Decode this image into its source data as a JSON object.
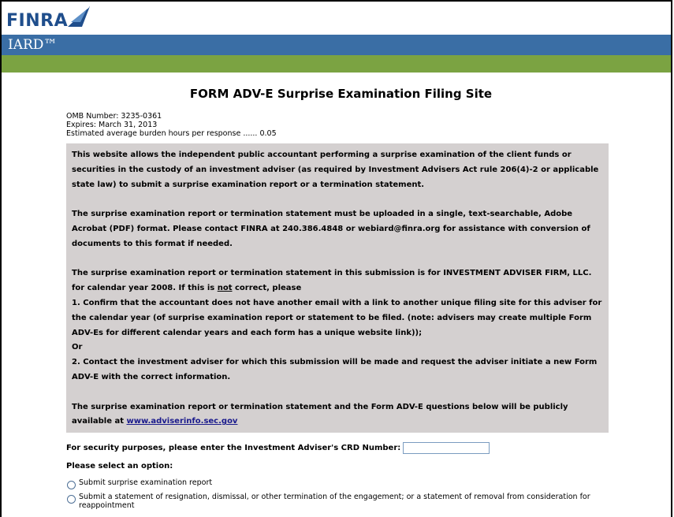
{
  "header": {
    "logo_text": "FINRA",
    "product_name": "IARD™"
  },
  "page": {
    "title": "FORM ADV-E Surprise Examination Filing Site"
  },
  "omb": {
    "number": "OMB Number: 3235-0361",
    "expires": "Expires: March 31, 2013",
    "burden": "Estimated average burden hours per response ...... 0.05"
  },
  "info": {
    "para1": "This website allows the independent public accountant performing a surprise examination of the client funds or securities in the custody of an investment adviser (as required by Investment Advisers Act rule 206(4)-2 or applicable state law) to submit a surprise examination report or a termination statement.",
    "para2": "The surprise examination report or termination statement must be uploaded in a single, text-searchable, Adobe Acrobat (PDF) format. Please contact FINRA at 240.386.4848 or webiard@finra.org for assistance with conversion of documents to this format if needed.",
    "para3_line1": "The surprise examination report or termination statement in this submission is for INVESTMENT ADVISER FIRM, LLC.",
    "para3_line2_pre": "for calendar year 2008. If this is ",
    "para3_line2_not": "not",
    "para3_line2_post": " correct, please",
    "para3_item1": "1. Confirm that the accountant does not have another email with a link to another unique filing site for this adviser for the calendar year (of surprise examination report or statement to be filed. (note: advisers may create multiple Form ADV-Es for different calendar years and each form has a unique website link));",
    "para3_or": "Or",
    "para3_item2": "2. Contact the investment adviser for which this submission will be made and request the adviser initiate a new Form ADV-E with the correct information.",
    "para4_pre": "The surprise examination report or termination statement and the Form ADV-E questions below will be publicly available at ",
    "para4_link": "www.adviserinfo.sec.gov"
  },
  "crd": {
    "label": "For security purposes, please enter the Investment Adviser's CRD Number:",
    "value": ""
  },
  "options": {
    "label": "Please select an option:",
    "items": [
      "Submit surprise examination report",
      "Submit a statement of resignation, dismissal, or other termination of the engagement; or a statement of removal from consideration for reappointment"
    ]
  },
  "colors": {
    "blue_bar": "#3a6ea5",
    "green_bar": "#7ba342",
    "info_box": "#d4d0d0",
    "logo": "#1f4e8c"
  }
}
